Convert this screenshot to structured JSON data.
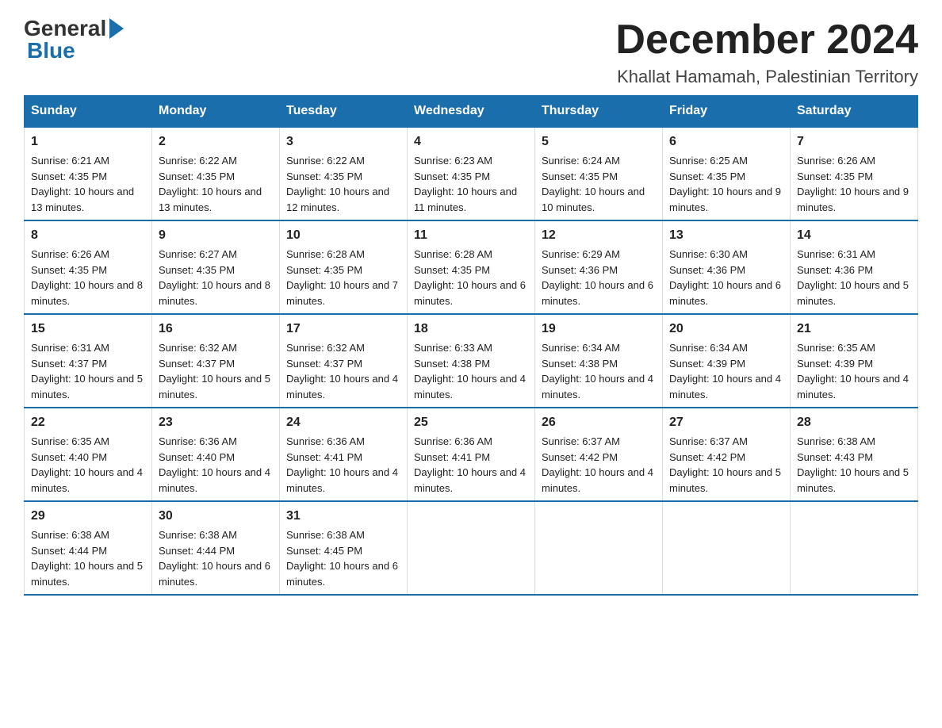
{
  "header": {
    "logo_general": "General",
    "logo_blue": "Blue",
    "month_title": "December 2024",
    "location": "Khallat Hamamah, Palestinian Territory"
  },
  "days_of_week": [
    "Sunday",
    "Monday",
    "Tuesday",
    "Wednesday",
    "Thursday",
    "Friday",
    "Saturday"
  ],
  "weeks": [
    [
      {
        "day": 1,
        "sunrise": "6:21 AM",
        "sunset": "4:35 PM",
        "daylight": "10 hours and 13 minutes."
      },
      {
        "day": 2,
        "sunrise": "6:22 AM",
        "sunset": "4:35 PM",
        "daylight": "10 hours and 13 minutes."
      },
      {
        "day": 3,
        "sunrise": "6:22 AM",
        "sunset": "4:35 PM",
        "daylight": "10 hours and 12 minutes."
      },
      {
        "day": 4,
        "sunrise": "6:23 AM",
        "sunset": "4:35 PM",
        "daylight": "10 hours and 11 minutes."
      },
      {
        "day": 5,
        "sunrise": "6:24 AM",
        "sunset": "4:35 PM",
        "daylight": "10 hours and 10 minutes."
      },
      {
        "day": 6,
        "sunrise": "6:25 AM",
        "sunset": "4:35 PM",
        "daylight": "10 hours and 9 minutes."
      },
      {
        "day": 7,
        "sunrise": "6:26 AM",
        "sunset": "4:35 PM",
        "daylight": "10 hours and 9 minutes."
      }
    ],
    [
      {
        "day": 8,
        "sunrise": "6:26 AM",
        "sunset": "4:35 PM",
        "daylight": "10 hours and 8 minutes."
      },
      {
        "day": 9,
        "sunrise": "6:27 AM",
        "sunset": "4:35 PM",
        "daylight": "10 hours and 8 minutes."
      },
      {
        "day": 10,
        "sunrise": "6:28 AM",
        "sunset": "4:35 PM",
        "daylight": "10 hours and 7 minutes."
      },
      {
        "day": 11,
        "sunrise": "6:28 AM",
        "sunset": "4:35 PM",
        "daylight": "10 hours and 6 minutes."
      },
      {
        "day": 12,
        "sunrise": "6:29 AM",
        "sunset": "4:36 PM",
        "daylight": "10 hours and 6 minutes."
      },
      {
        "day": 13,
        "sunrise": "6:30 AM",
        "sunset": "4:36 PM",
        "daylight": "10 hours and 6 minutes."
      },
      {
        "day": 14,
        "sunrise": "6:31 AM",
        "sunset": "4:36 PM",
        "daylight": "10 hours and 5 minutes."
      }
    ],
    [
      {
        "day": 15,
        "sunrise": "6:31 AM",
        "sunset": "4:37 PM",
        "daylight": "10 hours and 5 minutes."
      },
      {
        "day": 16,
        "sunrise": "6:32 AM",
        "sunset": "4:37 PM",
        "daylight": "10 hours and 5 minutes."
      },
      {
        "day": 17,
        "sunrise": "6:32 AM",
        "sunset": "4:37 PM",
        "daylight": "10 hours and 4 minutes."
      },
      {
        "day": 18,
        "sunrise": "6:33 AM",
        "sunset": "4:38 PM",
        "daylight": "10 hours and 4 minutes."
      },
      {
        "day": 19,
        "sunrise": "6:34 AM",
        "sunset": "4:38 PM",
        "daylight": "10 hours and 4 minutes."
      },
      {
        "day": 20,
        "sunrise": "6:34 AM",
        "sunset": "4:39 PM",
        "daylight": "10 hours and 4 minutes."
      },
      {
        "day": 21,
        "sunrise": "6:35 AM",
        "sunset": "4:39 PM",
        "daylight": "10 hours and 4 minutes."
      }
    ],
    [
      {
        "day": 22,
        "sunrise": "6:35 AM",
        "sunset": "4:40 PM",
        "daylight": "10 hours and 4 minutes."
      },
      {
        "day": 23,
        "sunrise": "6:36 AM",
        "sunset": "4:40 PM",
        "daylight": "10 hours and 4 minutes."
      },
      {
        "day": 24,
        "sunrise": "6:36 AM",
        "sunset": "4:41 PM",
        "daylight": "10 hours and 4 minutes."
      },
      {
        "day": 25,
        "sunrise": "6:36 AM",
        "sunset": "4:41 PM",
        "daylight": "10 hours and 4 minutes."
      },
      {
        "day": 26,
        "sunrise": "6:37 AM",
        "sunset": "4:42 PM",
        "daylight": "10 hours and 4 minutes."
      },
      {
        "day": 27,
        "sunrise": "6:37 AM",
        "sunset": "4:42 PM",
        "daylight": "10 hours and 5 minutes."
      },
      {
        "day": 28,
        "sunrise": "6:38 AM",
        "sunset": "4:43 PM",
        "daylight": "10 hours and 5 minutes."
      }
    ],
    [
      {
        "day": 29,
        "sunrise": "6:38 AM",
        "sunset": "4:44 PM",
        "daylight": "10 hours and 5 minutes."
      },
      {
        "day": 30,
        "sunrise": "6:38 AM",
        "sunset": "4:44 PM",
        "daylight": "10 hours and 6 minutes."
      },
      {
        "day": 31,
        "sunrise": "6:38 AM",
        "sunset": "4:45 PM",
        "daylight": "10 hours and 6 minutes."
      },
      null,
      null,
      null,
      null
    ]
  ],
  "labels": {
    "sunrise": "Sunrise:",
    "sunset": "Sunset:",
    "daylight": "Daylight:"
  }
}
